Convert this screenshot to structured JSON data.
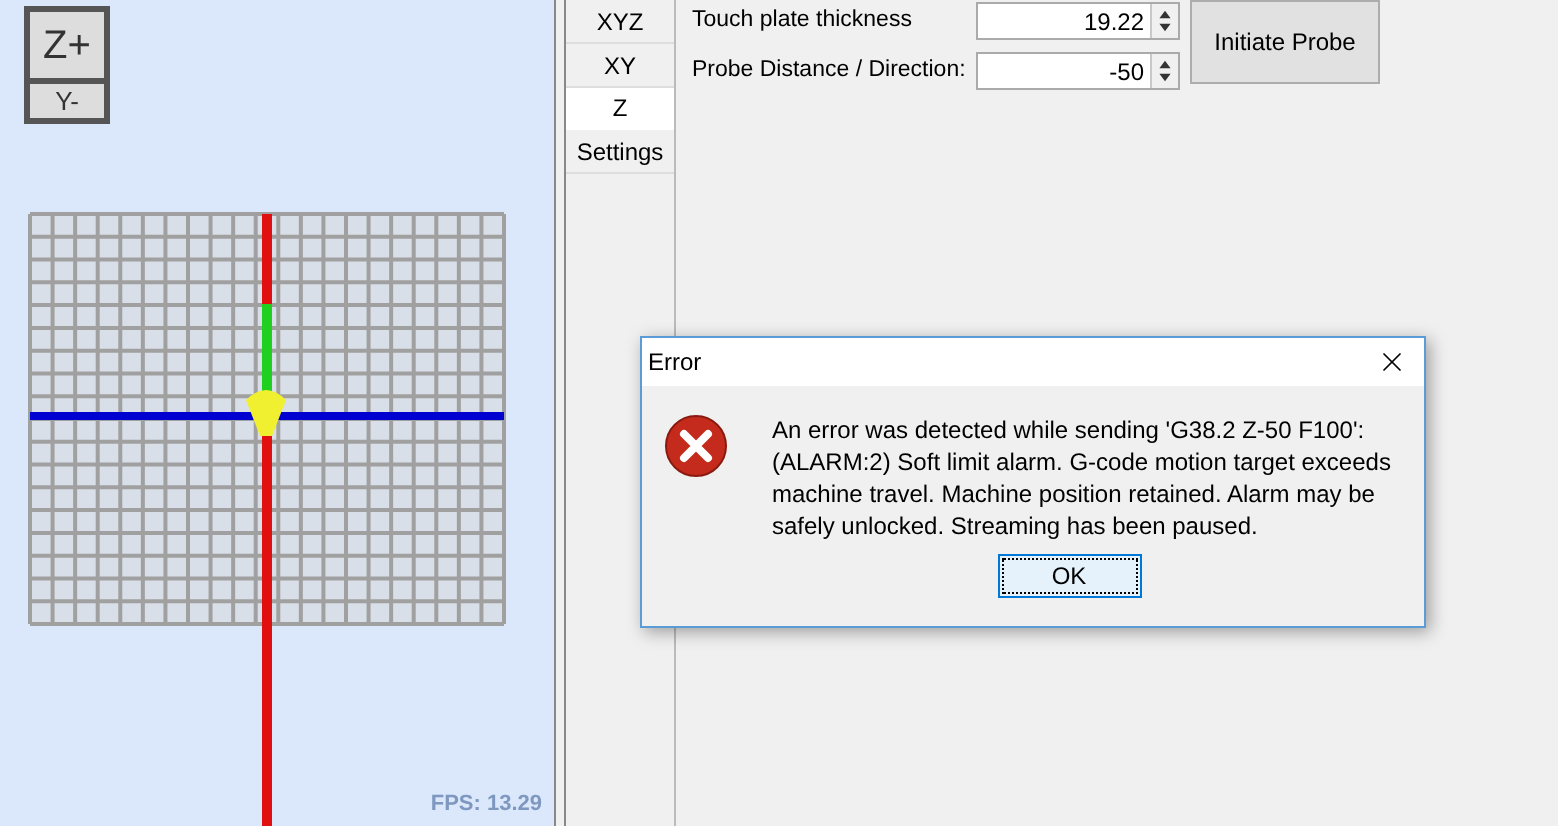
{
  "viewport": {
    "view_buttons": [
      "Z+",
      "Y-"
    ],
    "fps": "FPS: 13.29"
  },
  "tabs": [
    {
      "label": "XYZ",
      "selected": false
    },
    {
      "label": "XY",
      "selected": false
    },
    {
      "label": "Z",
      "selected": true
    },
    {
      "label": "Settings",
      "selected": false
    }
  ],
  "probe": {
    "fields": [
      {
        "label": "Touch plate thickness",
        "value": "19.22"
      },
      {
        "label": "Probe Distance / Direction:",
        "value": "-50"
      }
    ],
    "button": "Initiate Probe"
  },
  "dialog": {
    "title": "Error",
    "message": "An error was detected while sending 'G38.2 Z-50 F100': (ALARM:2) Soft limit alarm. G-code motion target exceeds machine travel. Machine position retained. Alarm may be safely unlocked. Streaming has been paused.",
    "button": "OK"
  }
}
